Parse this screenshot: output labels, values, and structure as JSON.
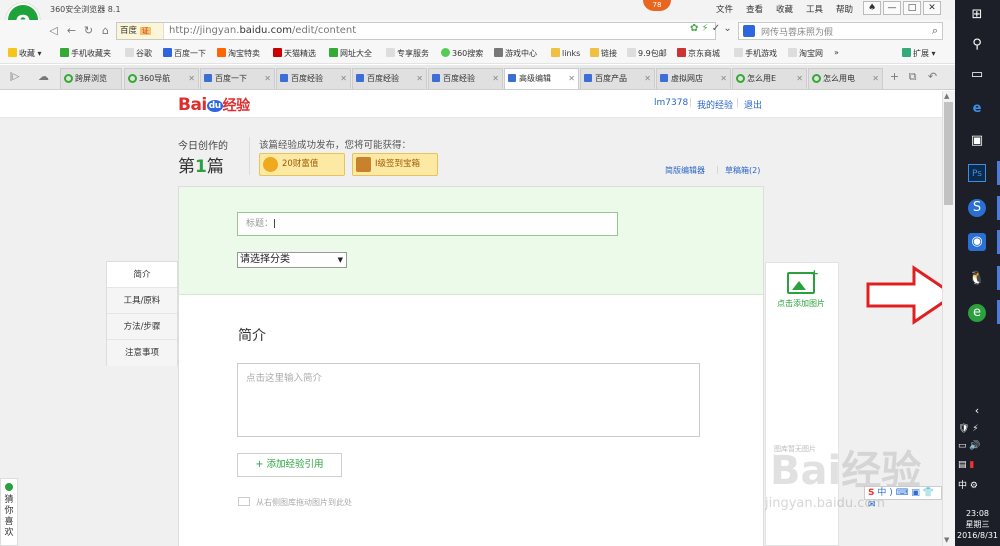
{
  "browser": {
    "app_title": "360安全浏览器 8.1",
    "notif_count": "78",
    "menu": [
      "文件",
      "查看",
      "收藏",
      "工具",
      "帮助"
    ],
    "window_buttons": [
      "—",
      "□",
      "✕"
    ],
    "url_badge": "百度",
    "url_badge_tag": "证",
    "url_prefix": "http://jingyan.",
    "url_domain": "baidu.com",
    "url_path": "/edit/content",
    "search_text": "网传马蓉床照为假",
    "bookmarks": [
      "收藏",
      "手机收藏夹",
      "谷歌",
      "百度一下",
      "淘宝特卖",
      "天猫精选",
      "网址大全",
      "专享服务",
      "360搜索",
      "游戏中心",
      "links",
      "链接",
      "9.9包邮",
      "京东商城",
      "手机游戏",
      "淘宝网",
      "»",
      "扩展"
    ],
    "tabs": [
      "跨屏浏览",
      "360导航",
      "百度一下",
      "百度经验",
      "百度经验",
      "百度经验",
      "高级编辑",
      "百度产品",
      "虚拟网店",
      "怎么用E",
      "怎么用电"
    ],
    "colors": {
      "brand_green": "#2aa13c",
      "link_blue": "#2a64c8",
      "accent_orange": "#e8661f"
    }
  },
  "page": {
    "logo_text": "Bai",
    "logo_du": "du",
    "logo_jy": "经验",
    "user": "lm7378",
    "my_experience": "我的经验",
    "logout": "退出",
    "today_label": "今日创作的",
    "count_pre": "第",
    "count_num": "1",
    "count_post": "篇",
    "hint": "该篇经验成功发布，您将可能获得：",
    "reward1": "20财富值",
    "reward2": "I级签到宝箱",
    "simple_editor": "简版编辑器",
    "drafts": "草稿箱(2)",
    "title_placeholder": "标题：",
    "category": "请选择分类",
    "nav": [
      "简介",
      "工具/原料",
      "方法/步骤",
      "注意事项"
    ],
    "intro_label": "简介",
    "intro_placeholder": "点击这里输入简介",
    "add_ref": "+ 添加经验引用",
    "drag_hint": "从右侧图库拖动图片到此处",
    "add_image": "点击添加图片",
    "no_image": "图库暂无图片",
    "guess": [
      "猜",
      "你",
      "喜",
      "欢"
    ],
    "watermark": "Bai经验",
    "watermark_url": "jingyan.baidu.com"
  },
  "taskbar": {
    "time": "23:08",
    "weekday": "星期三",
    "date": "2016/8/31"
  }
}
